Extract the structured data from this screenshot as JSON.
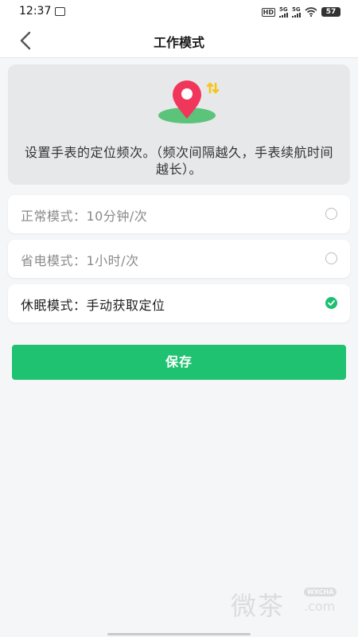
{
  "status_bar": {
    "time": "12:37",
    "hd_label": "HD",
    "network_1": "5G",
    "network_2": "5G",
    "battery": "57"
  },
  "header": {
    "title": "工作模式",
    "back_icon": "chevron-left-icon"
  },
  "info": {
    "icon": "location-pin-swap-icon",
    "description": "设置手表的定位频次。（频次间隔越久，手表续航时间越长）。"
  },
  "modes": [
    {
      "label": "正常模式：10分钟/次",
      "selected": false
    },
    {
      "label": "省电模式：1小时/次",
      "selected": false
    },
    {
      "label": "休眠模式：手动获取定位",
      "selected": true
    }
  ],
  "save_button": {
    "label": "保存"
  },
  "watermark": {
    "text": "微茶",
    "badge": "WXCHA",
    "domain": ".com"
  },
  "colors": {
    "accent": "#1fc270",
    "pin": "#f0375b",
    "pin_shadow": "#5cc37a",
    "arrows": "#f5c518",
    "card_bg": "#e7e8ea"
  }
}
